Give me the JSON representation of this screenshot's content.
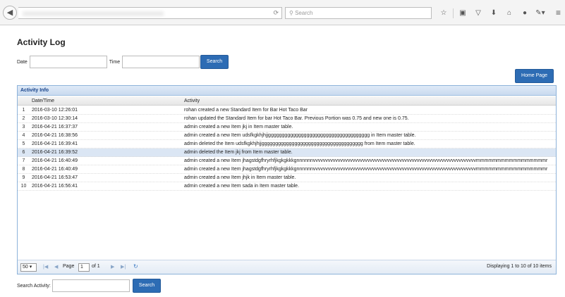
{
  "browser": {
    "search_placeholder": "Search"
  },
  "page": {
    "title": "Activity Log"
  },
  "filters": {
    "date_label": "Date",
    "time_label": "Time",
    "search_button": "Search"
  },
  "home_button": "Home Page",
  "grid": {
    "title": "Activity Info",
    "columns": [
      "Date/Time",
      "Activity"
    ],
    "rows": [
      {
        "num": "1",
        "datetime": "2016-03-10 12:26:01",
        "activity": "rohan created a new Standard Item for Bar Hot Taco Bar"
      },
      {
        "num": "2",
        "datetime": "2016-03-10 12:30:14",
        "activity": "rohan updated the Standard Item for bar Hot Taco Bar. Previous Portion was 0.75 and new one is 0.75."
      },
      {
        "num": "3",
        "datetime": "2016-04-21 16:37:37",
        "activity": "admin created a new Item jkj in Item master table."
      },
      {
        "num": "4",
        "datetime": "2016-04-21 16:38:56",
        "activity": "admin created a new Item udsfkgkhjhjjggggggggggggggggggggggggggggggggggggg in Item master table."
      },
      {
        "num": "5",
        "datetime": "2016-04-21 16:39:41",
        "activity": "admin deleted the Item udsfkgkhjhjjggggggggggggggggggggggggggggggggggggg from Item master table."
      },
      {
        "num": "6",
        "datetime": "2016-04-21 16:39:52",
        "activity": "admin deleted the Item jkj from Item master table."
      },
      {
        "num": "7",
        "datetime": "2016-04-21 16:40:49",
        "activity": "admin created a new Item jhagstdgfhryrhfjkgkgkkkgnnnnnnvvvvvvvvvvvvvvvvvvvvvvvvvvvvvvvvvvvvvvvvvvvvvvvvvvvvvvvvvvvvvvvvvvmmmmmmmmmmmmmmmmmr"
      },
      {
        "num": "8",
        "datetime": "2016-04-21 16:40:49",
        "activity": "admin created a new Item jhagstdgfhryrhfjkgkgkkkgnnnnnnvvvvvvvvvvvvvvvvvvvvvvvvvvvvvvvvvvvvvvvvvvvvvvvvvvvvvvvvvvvvvvvvvvmmmmmmmmmmmmmmmmmr"
      },
      {
        "num": "9",
        "datetime": "2016-04-21 16:53:47",
        "activity": "admin created a new Item jhjk in Item master table."
      },
      {
        "num": "10",
        "datetime": "2016-04-21 16:56:41",
        "activity": "admin created a new Item sada in Item master table."
      }
    ],
    "selected_row": 6
  },
  "pager": {
    "page_size": "50",
    "page_label": "Page",
    "page_value": "1",
    "of_label": "of 1",
    "display_text": "Displaying 1 to 10 of 10 items"
  },
  "footer": {
    "search_label": "Search Activity:",
    "search_button": "Search"
  }
}
